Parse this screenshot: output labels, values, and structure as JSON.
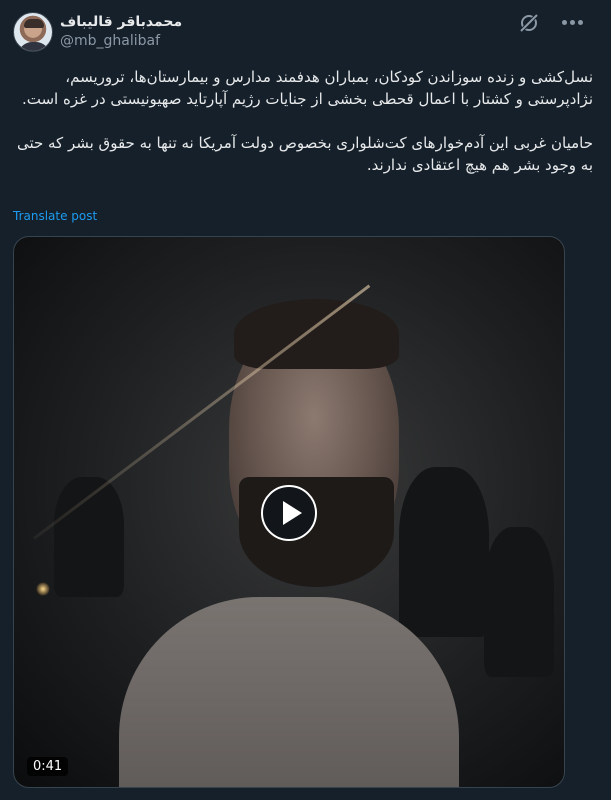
{
  "author": {
    "display_name": "محمدباقر قالیباف",
    "handle": "@mb_ghalibaf",
    "avatar_icon": "profile-photo"
  },
  "header_icons": {
    "grok": "grok-icon",
    "more": "more-options-icon"
  },
  "post": {
    "paragraphs": [
      "نسل‌کشی و زنده سوزاندن کودکان، بمباران هدفمند مدارس و بیمارستان‌ها، تروریسم، نژادپرستی و کشتار با اعمال قحطی بخشی از جنایات رژیم آپارتاید صهیونیستی در غزه است.",
      "حامیان غربی این آدم‌خوارهای کت‌شلواری بخصوص دولت آمریکا نه تنها به حقوق بشر که حتی به وجود بشر هم هیچ اعتقادی ندارند."
    ],
    "translate_label": "Translate post"
  },
  "media": {
    "type": "video",
    "duration": "0:41",
    "play_icon": "play-icon"
  },
  "colors": {
    "background": "#15202b",
    "text": "#e7e9ea",
    "secondary_text": "#8b98a5",
    "link": "#1d9bf0",
    "border": "#38444d"
  }
}
